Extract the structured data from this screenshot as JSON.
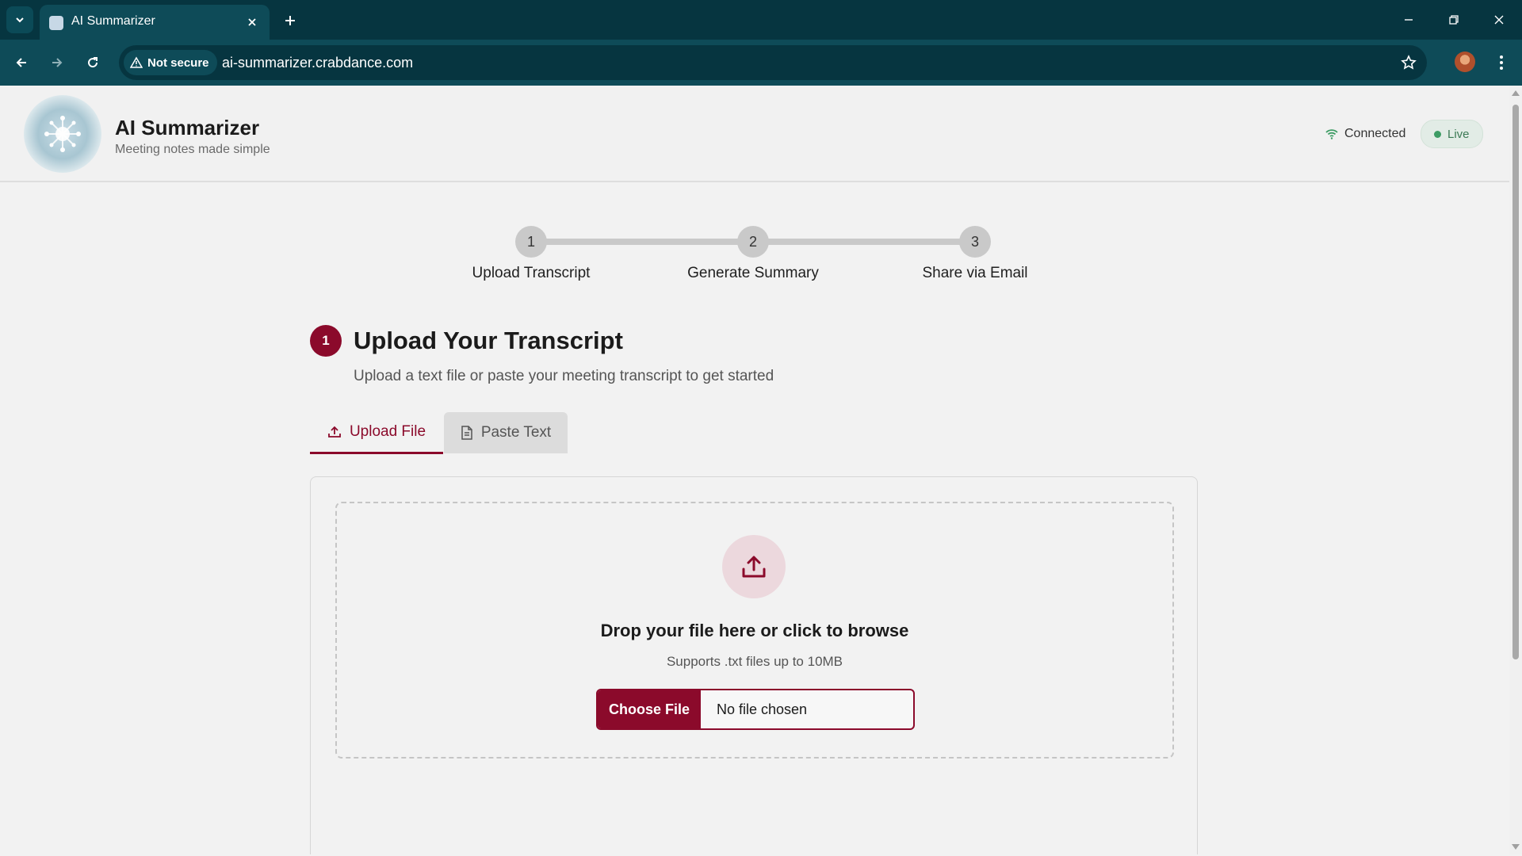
{
  "browser": {
    "tab_title": "AI Summarizer",
    "security_label": "Not secure",
    "url": "ai-summarizer.crabdance.com"
  },
  "header": {
    "title": "AI Summarizer",
    "subtitle": "Meeting notes made simple",
    "connection_status": "Connected",
    "live_badge": "Live"
  },
  "stepper": {
    "steps": [
      {
        "number": "1",
        "label": "Upload Transcript"
      },
      {
        "number": "2",
        "label": "Generate Summary"
      },
      {
        "number": "3",
        "label": "Share via Email"
      }
    ]
  },
  "section": {
    "number": "1",
    "title": "Upload Your Transcript",
    "description": "Upload a text file or paste your meeting transcript to get started"
  },
  "tabs": {
    "upload_label": "Upload File",
    "paste_label": "Paste Text"
  },
  "dropzone": {
    "title": "Drop your file here or click to browse",
    "subtitle": "Supports .txt files up to 10MB",
    "choose_file_label": "Choose File",
    "file_status": "No file chosen"
  },
  "colors": {
    "accent": "#8b0a2b",
    "browser_dark": "#063540",
    "browser_toolbar": "#0e4b58",
    "live_green": "#3d9c64"
  }
}
